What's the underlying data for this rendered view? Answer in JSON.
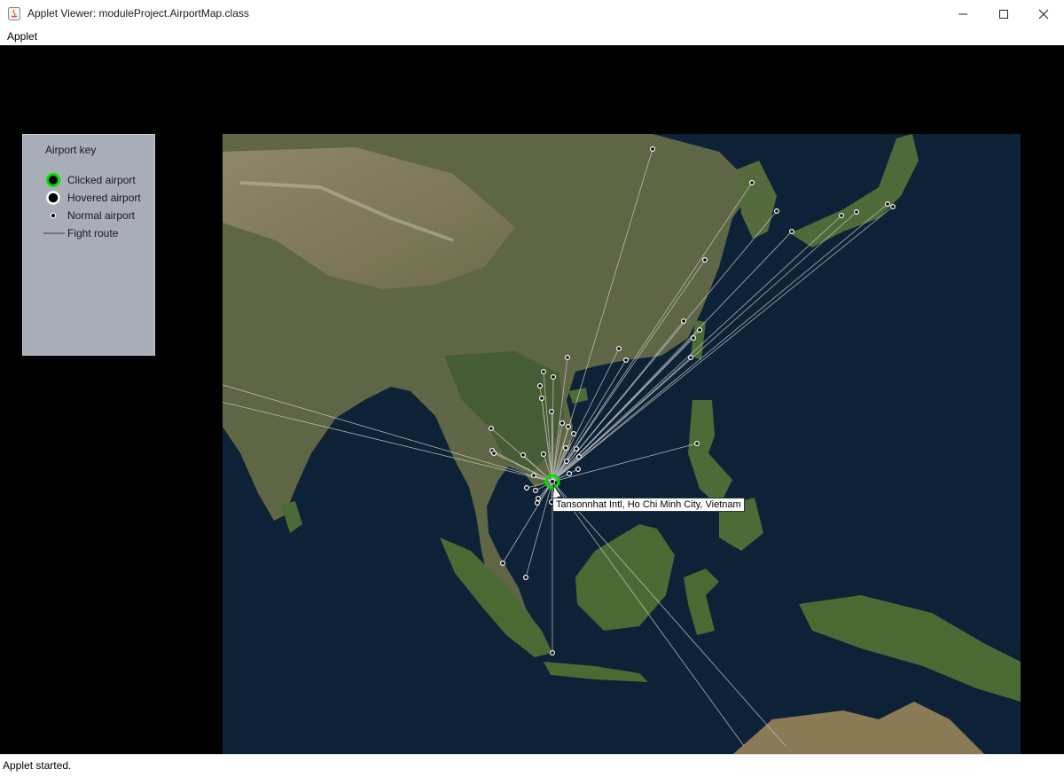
{
  "window": {
    "title": "Applet Viewer: moduleProject.AirportMap.class",
    "controls": [
      "minimize-icon",
      "maximize-icon",
      "close-icon"
    ]
  },
  "menubar": {
    "items": [
      {
        "label": "Applet"
      }
    ]
  },
  "key": {
    "title": "Airport key",
    "items": [
      {
        "label": "Clicked airport",
        "icon": "clicked-airport-icon"
      },
      {
        "label": "Hovered airport",
        "icon": "hovered-airport-icon"
      },
      {
        "label": "Normal airport",
        "icon": "normal-airport-icon"
      },
      {
        "label": "Fight route",
        "icon": "flight-route-icon"
      }
    ]
  },
  "map": {
    "tooltip": "Tansonnhat Intl, Ho Chi Minh City, Vietnam",
    "colors": {
      "clicked": "#00e000",
      "route": "#c8c8c8",
      "marker": "#ffffff",
      "ocean": "#0d2236"
    }
  },
  "status": {
    "text": "Applet started."
  }
}
